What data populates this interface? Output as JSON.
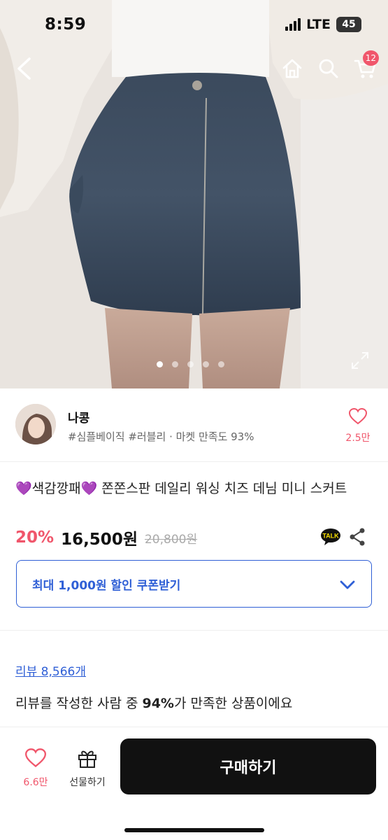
{
  "status_bar": {
    "time": "8:59",
    "network": "LTE",
    "battery": "45"
  },
  "nav": {
    "cart_badge": "12"
  },
  "icons": {
    "back": "chevron-left-icon",
    "home": "home-icon",
    "search": "search-icon",
    "cart": "cart-icon",
    "expand": "expand-icon",
    "heart": "heart-icon",
    "talk": "kakaotalk-icon",
    "share": "share-icon",
    "chevron": "chevron-down-icon",
    "gift": "gift-icon"
  },
  "carousel": {
    "total": 5,
    "active": 1
  },
  "seller": {
    "name": "나콩",
    "tags": "#심플베이직 #러블리 · 마켓 만족도 93%",
    "favorites": "2.5만"
  },
  "product": {
    "title_emoji": "💜",
    "title_lead": "색감깡패",
    "title_rest": " 쫀쫀스판 데일리 워싱 치즈 데님 미니 스커트",
    "discount": "20%",
    "price": "16,500원",
    "original_price": "20,800원",
    "talk_label": "TALK"
  },
  "coupon": {
    "label": "최대 1,000원 할인 쿠폰받기"
  },
  "reviews": {
    "link": "리뷰 8,566개",
    "summary_prefix": "리뷰를 작성한 사람 중 ",
    "summary_percent": "94%",
    "summary_suffix": "가 만족한 상품이에요"
  },
  "bottom_bar": {
    "likes": "6.6만",
    "gift_label": "선물하기",
    "buy_label": "구매하기"
  },
  "colors": {
    "accent_pink": "#f0566b",
    "accent_blue": "#2f5fd6",
    "buy_button": "#111111"
  }
}
